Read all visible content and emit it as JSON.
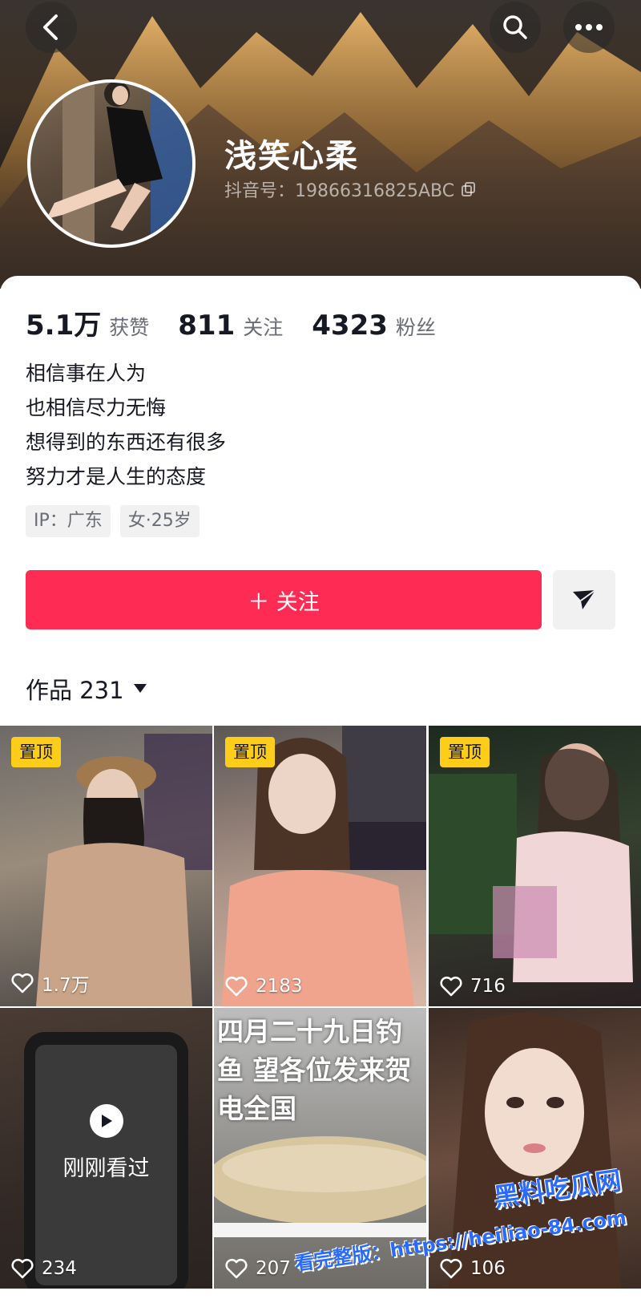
{
  "profile": {
    "nickname": "浅笑心柔",
    "douyin_id": "抖音号：19866316825ABC"
  },
  "stats": [
    {
      "value": "5.1万",
      "label": "获赞"
    },
    {
      "value": "811",
      "label": "关注"
    },
    {
      "value": "4323",
      "label": "粉丝"
    }
  ],
  "bio": {
    "line1": "相信事在人为",
    "line2": "也相信尽力无悔",
    "line3": "想得到的东西还有很多",
    "line4": "努力才是人生的态度"
  },
  "tags": {
    "ip": "IP：广东",
    "gender_age": "女·25岁"
  },
  "actions": {
    "follow_label": "＋ 关注"
  },
  "works": {
    "title": "作品 231"
  },
  "videos": [
    {
      "pinned": "置顶",
      "likes": "1.7万"
    },
    {
      "pinned": "置顶",
      "likes": "2183"
    },
    {
      "pinned": "置顶",
      "likes": "716"
    },
    {
      "overlay": "刚刚看过",
      "likes": "234"
    },
    {
      "caption": "四月二十九日钓鱼 望各位发来贺电全国",
      "likes": "207"
    },
    {
      "likes": "106"
    }
  ],
  "watermark": {
    "line1": "黑料吃瓜网",
    "line2": "看完整版：https://heiliao-84.com"
  },
  "colors": {
    "accent": "#fe2c55",
    "pin_badge": "#fecd1a"
  }
}
